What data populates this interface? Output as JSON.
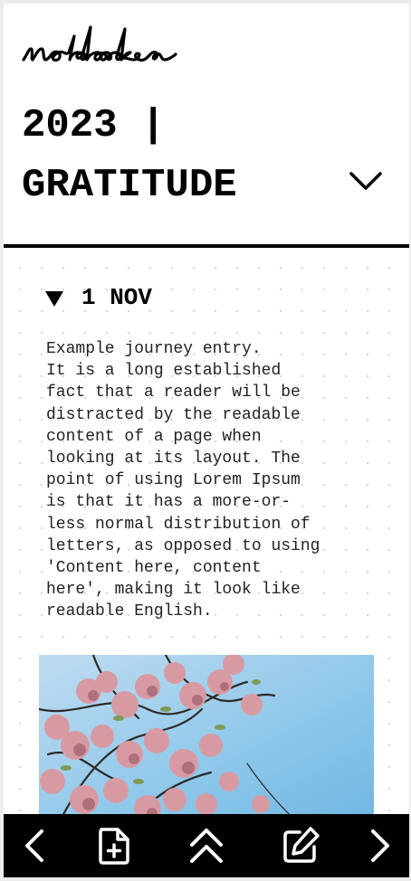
{
  "app": {
    "logo_text": "notebooks",
    "notebook_title": "2023 |\nGRATITUDE",
    "icons": {
      "dropdown": "chevron-down-icon"
    }
  },
  "entry": {
    "date_label": "1 NOV",
    "expanded": true,
    "body": "Example journey entry.\nIt is a long established\nfact that a reader will be\ndistracted by the readable\ncontent of a page when\nlooking at its layout. The\npoint of using Lorem Ipsum\nis that it has a more-or-\nless normal distribution of\nletters, as opposed to using\n'Content here, content\nhere', making it look like\nreadable English.",
    "image": "cherry-blossom-photo"
  },
  "toolbar": {
    "items": [
      {
        "icon": "chevron-left-icon",
        "action": "previous"
      },
      {
        "icon": "add-page-icon",
        "action": "new-page"
      },
      {
        "icon": "double-chevron-up-icon",
        "action": "collapse"
      },
      {
        "icon": "edit-icon",
        "action": "edit"
      },
      {
        "icon": "chevron-right-icon",
        "action": "next"
      }
    ]
  },
  "colors": {
    "background": "#ffffff",
    "text": "#000000",
    "toolbar": "#000000",
    "toolbar_icon": "#ffffff",
    "grid_dot": "#d4d4d4"
  }
}
